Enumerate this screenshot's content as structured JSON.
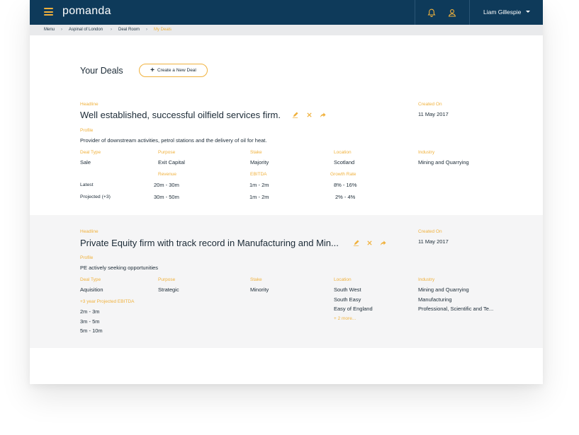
{
  "topbar": {
    "logo": "pomanda",
    "user_name": "Liam Gillespie",
    "icons": [
      "menu-icon",
      "bell-icon",
      "user-icon",
      "caret-down-icon"
    ],
    "brand_color": "#0e3a5a",
    "accent_color": "#f0b13c"
  },
  "breadcrumb": [
    "Menu",
    "Aspinal of London",
    "Deal Room",
    "My Deals"
  ],
  "page": {
    "title": "Your Deals",
    "new_deal_label": "Create a New Deal"
  },
  "deals": [
    {
      "headline_label": "Headline",
      "headline": "Well established, successful oilfield services firm.",
      "created_label": "Created On",
      "created": "11 May 2017",
      "profile_label": "Profile",
      "profile": "Provider of downstream activities, petrol stations and the delivery of oil for heat.",
      "deal_type_label": "Deal Type",
      "deal_type": "Sale",
      "purpose_label": "Purpose",
      "purpose": "Exit Capital",
      "stake_label": "Stake",
      "stake": "Majority",
      "location_label": "Location",
      "location": "Scotland",
      "industry_label": "Industry",
      "industry": "Mining and Quarrying",
      "revenue_label": "Revenue",
      "ebitda_label": "EBITDA",
      "growth_label": "Growth Rate",
      "latest_label": "Latest",
      "projected_label": "Projected (+3)",
      "revenue_latest": "20m - 30m",
      "revenue_projected": "30m - 50m",
      "ebitda_latest": "1m - 2m",
      "ebitda_projected": "1m - 2m",
      "growth_latest": "8% - 16%",
      "growth_projected": "2% - 4%"
    },
    {
      "headline_label": "Headline",
      "headline": "Private Equity firm with track record in Manufacturing and Min...",
      "created_label": "Created On",
      "created": "11 May 2017",
      "profile_label": "Profile",
      "profile": "PE actively seeking opportunities",
      "deal_type_label": "Deal Type",
      "deal_type": "Aquisition",
      "purpose_label": "Purpose",
      "purpose": "Strategic",
      "stake_label": "Stake",
      "stake": "Minority",
      "location_label": "Location",
      "locations": [
        "South West",
        "South Easy",
        "Easy of England"
      ],
      "locations_more": "+ 2 more...",
      "industry_label": "Industry",
      "industries": [
        "Mining and Quarrying",
        "Manufacturing",
        "Professional, Scientific and Te..."
      ],
      "ebitda_proj_label": "+3 year Projected EBITDA",
      "ebitda_ranges": [
        "2m - 3m",
        "3m - 5m",
        "5m - 10m"
      ]
    }
  ]
}
